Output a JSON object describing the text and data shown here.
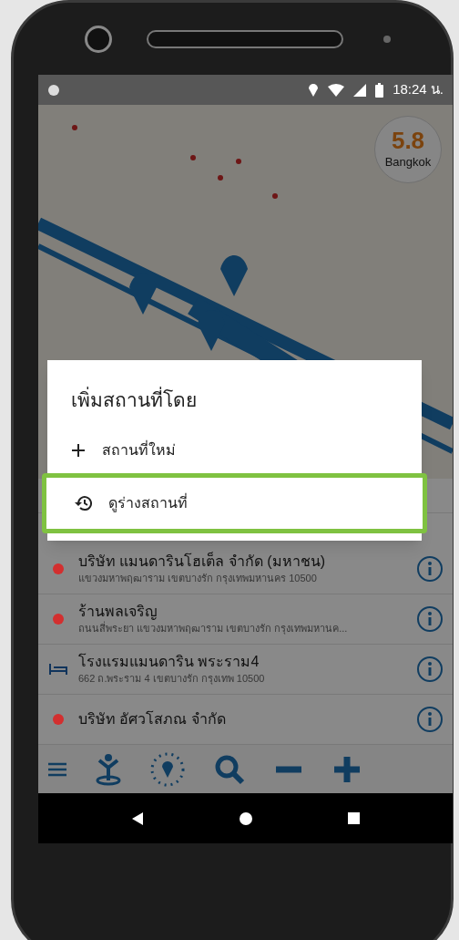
{
  "status_bar": {
    "time": "18:24 น."
  },
  "map_badge": {
    "value": "5.8",
    "city": "Bangkok"
  },
  "dialog": {
    "title": "เพิ่มสถานที่โดย",
    "options": [
      {
        "kind": "new",
        "label": "สถานที่ใหม่",
        "highlighted": false
      },
      {
        "kind": "history",
        "label": "ดูร่างสถานที่",
        "highlighted": true
      }
    ]
  },
  "places": [
    {
      "kind": "dot",
      "color": "#d32f2f",
      "name": "บริษัท แมนดารินโฮเต็ล จำกัด (มหาชน)",
      "address": "แขวงมหาพฤฒาราม เขตบางรัก กรุงเทพมหานคร 10500"
    },
    {
      "kind": "dot",
      "color": "#d32f2f",
      "name": "ร้านพลเจริญ",
      "address": "ถนนสี่พระยา แขวงมหาพฤฒาราม เขตบางรัก กรุงเทพมหานค..."
    },
    {
      "kind": "hotel",
      "name": "โรงแรมแมนดาริน พระราม4",
      "address": "662 ถ.พระราม 4 เขตบางรัก กรุงเทพ 10500"
    },
    {
      "kind": "dot",
      "color": "#d32f2f",
      "name": "บริษัท อัศวโสภณ จำกัด"
    }
  ]
}
